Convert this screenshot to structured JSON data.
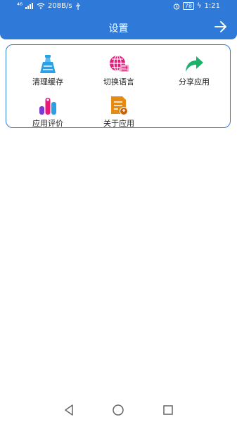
{
  "status": {
    "signal": "⁴⁶",
    "speed": "208B/s",
    "battery": "78",
    "time": "1:21"
  },
  "header": {
    "title": "设置"
  },
  "menu": {
    "items": [
      {
        "label": "清理缓存",
        "icon": "broom-icon"
      },
      {
        "label": "切换语言",
        "icon": "globe-language-icon"
      },
      {
        "label": "分享应用",
        "icon": "share-arrow-icon"
      },
      {
        "label": "应用评价",
        "icon": "rating-bars-icon"
      },
      {
        "label": "关于应用",
        "icon": "about-document-icon"
      }
    ]
  },
  "colors": {
    "primary": "#2f7ad9",
    "clean": "#2aa0e6",
    "language": "#e8197a",
    "share": "#19b26b",
    "rate": "#7a38d8",
    "about": "#e58b13"
  }
}
